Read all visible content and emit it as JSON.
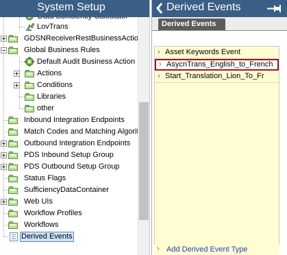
{
  "left_panel": {
    "title": "System Setup",
    "tree": [
      {
        "label": "Data Sufficiency Calculator",
        "indent": 2,
        "icon": "gear-icon",
        "expander": null
      },
      {
        "label": "LovTrans",
        "indent": 2,
        "icon": "gear-icon",
        "expander": null
      },
      {
        "label": "GDSNReceiverRestBusinessActions",
        "indent": 0,
        "icon": "folder-icon",
        "expander": "plus"
      },
      {
        "label": "Global Business Rules",
        "indent": 0,
        "icon": "folder-icon",
        "expander": "minus"
      },
      {
        "label": "Default Audit Business Action",
        "indent": 1,
        "icon": "gear-icon",
        "expander": null
      },
      {
        "label": "Actions",
        "indent": 1,
        "icon": "folder-icon",
        "expander": "plus"
      },
      {
        "label": "Conditions",
        "indent": 1,
        "icon": "folder-icon",
        "expander": "plus"
      },
      {
        "label": "Libraries",
        "indent": 1,
        "icon": "folder-icon",
        "expander": null
      },
      {
        "label": "other",
        "indent": 1,
        "icon": "folder-icon",
        "expander": null
      },
      {
        "label": "Inbound Integration Endpoints",
        "indent": 0,
        "icon": "folder-icon",
        "expander": null
      },
      {
        "label": "Match Codes and Matching Algorithms",
        "indent": 0,
        "icon": "folder-icon",
        "expander": null
      },
      {
        "label": "Outbound Integration Endpoints",
        "indent": 0,
        "icon": "folder-icon",
        "expander": "plus"
      },
      {
        "label": "PDS Inbound Setup Group",
        "indent": 0,
        "icon": "folder-icon",
        "expander": "plus"
      },
      {
        "label": "PDS Outbound Setup Group",
        "indent": 0,
        "icon": "folder-icon",
        "expander": "plus"
      },
      {
        "label": "Status Flags",
        "indent": 0,
        "icon": "folder-icon",
        "expander": null
      },
      {
        "label": "SufficiencyDataContainer",
        "indent": 0,
        "icon": "folder-icon",
        "expander": null
      },
      {
        "label": "Web UIs",
        "indent": 0,
        "icon": "folder-icon",
        "expander": "plus"
      },
      {
        "label": "Workflow Profiles",
        "indent": 0,
        "icon": "folder-icon",
        "expander": null
      },
      {
        "label": "Workflows",
        "indent": 0,
        "icon": "folder-icon",
        "expander": null
      },
      {
        "label": "Derived Events",
        "indent": 0,
        "icon": "document-icon",
        "expander": null,
        "selected": true
      }
    ]
  },
  "right_panel": {
    "title": "Derived Events",
    "tab_label": "Derived Events",
    "items": [
      {
        "label": "Asset Keywords Event",
        "selected": false
      },
      {
        "label": "AsycnTrans_English_to_French",
        "selected": true
      },
      {
        "label": "Start_Translation_Lion_To_Fr",
        "selected": false
      }
    ],
    "add_link": "Add Derived Event Type"
  },
  "colors": {
    "header_bg": "#3a5f86",
    "folder_green": "#b9e39a",
    "list_bg": "#fffdd2",
    "selection_border": "#9b1b1b",
    "link": "#2342b5"
  }
}
